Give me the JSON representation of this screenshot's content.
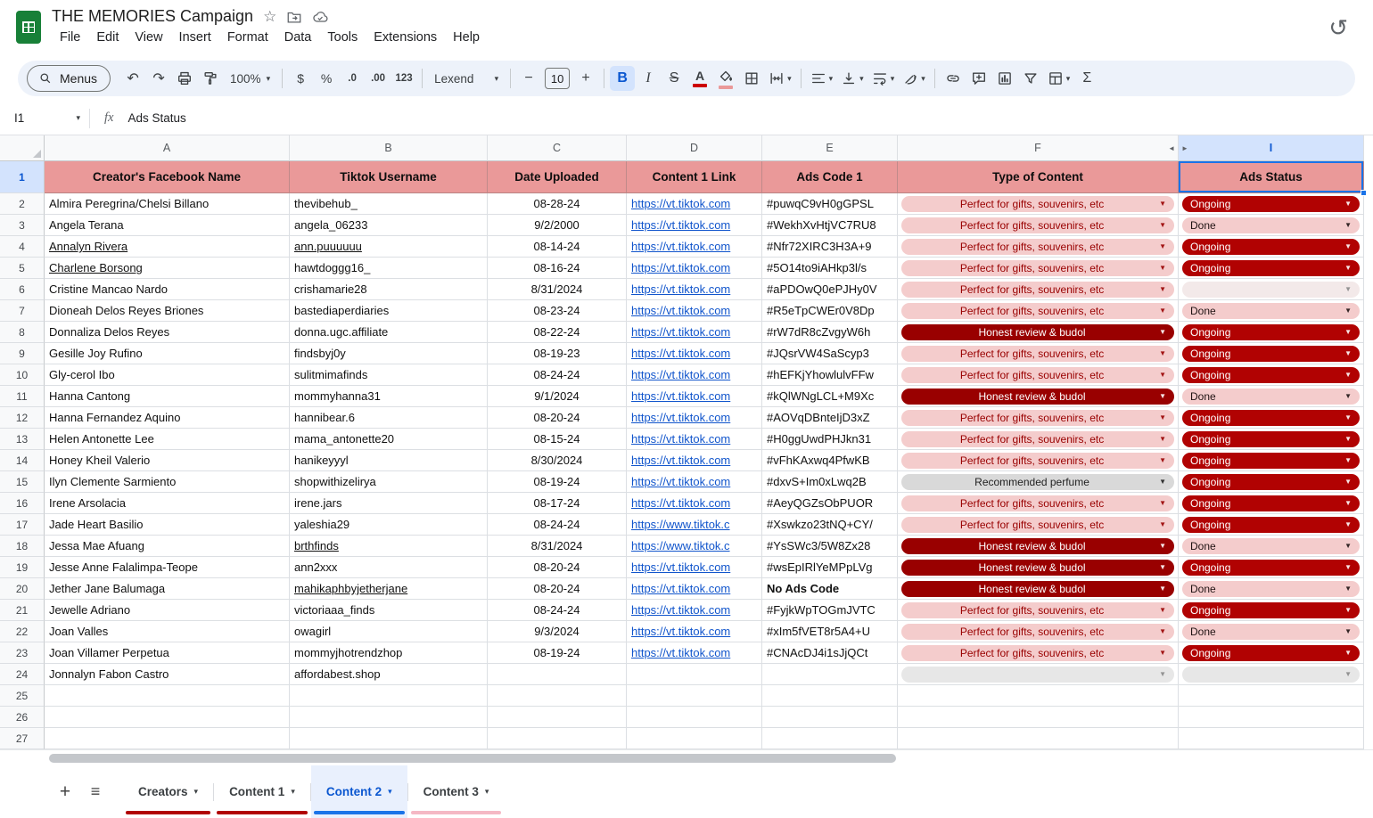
{
  "app": {
    "title": "THE MEMORIES Campaign",
    "menus": [
      "File",
      "Edit",
      "View",
      "Insert",
      "Format",
      "Data",
      "Tools",
      "Extensions",
      "Help"
    ]
  },
  "icons": {
    "undo": "↶",
    "redo": "↷",
    "star": "☆",
    "sigma": "Σ",
    "history": "↺",
    "dropdown": "▾",
    "chip_arrow": "▼",
    "plus": "+",
    "hamburger": "≡",
    "left_hidden": "◄",
    "right_hidden": "►"
  },
  "toolbar": {
    "menus_label": "Menus",
    "zoom_value": "100%",
    "currency": "$",
    "percent": "%",
    "dec_decrease": ".0",
    "dec_increase": ".00",
    "more_formats": "123",
    "font_name": "Lexend",
    "font_size": "10",
    "minus": "−",
    "plus": "+",
    "bold": "B",
    "italic": "I",
    "strike": "S",
    "text_color": "A"
  },
  "formula_bar": {
    "cell_ref": "I1",
    "fx": "fx",
    "value": "Ads Status"
  },
  "colors": {
    "header_fill": "#ea9999",
    "chip_light": "#f4cccc",
    "chip_dark_red": "#990000",
    "status_red": "#b10202",
    "chip_gray": "#d9d9d9",
    "selection_blue": "#1a73e8",
    "link_blue": "#1155cc",
    "text_color_indicator": "#cc0000",
    "fill_color_indicator": "#ea9999"
  },
  "grid": {
    "col_letters": [
      "A",
      "B",
      "C",
      "D",
      "E",
      "F",
      "I"
    ],
    "headers": [
      "Creator's Facebook Name",
      "Tiktok Username",
      "Date Uploaded",
      "Content 1 Link",
      "Ads Code 1",
      "Type of Content",
      "Ads Status"
    ],
    "header_row_number": 1,
    "empty_row_numbers": [
      25,
      26,
      27
    ],
    "rows": [
      {
        "n": 2,
        "name": "Almira Peregrina/Chelsi Billano",
        "user": "thevibehub_",
        "date": "08-28-24",
        "link": "https://vt.tiktok.com",
        "code": "#puwqC9vH0gGPSL",
        "type": {
          "label": "Perfect for gifts, souvenirs, etc",
          "style": "pink"
        },
        "status": {
          "label": "Ongoing",
          "style": "ongoing"
        }
      },
      {
        "n": 3,
        "name": "Angela Terana",
        "user": "angela_06233",
        "date": "9/2/2000",
        "link": "https://vt.tiktok.com",
        "code": "#WekhXvHtjVC7RU8",
        "type": {
          "label": "Perfect for gifts, souvenirs, etc",
          "style": "pink"
        },
        "status": {
          "label": "Done",
          "style": "done"
        }
      },
      {
        "n": 4,
        "name": "Annalyn Rivera",
        "nu": true,
        "user": "ann.puuuuuu",
        "uu": true,
        "date": "08-14-24",
        "link": "https://vt.tiktok.com",
        "code": "#Nfr72XIRC3H3A+9",
        "type": {
          "label": "Perfect for gifts, souvenirs, etc",
          "style": "pink"
        },
        "status": {
          "label": "Ongoing",
          "style": "ongoing"
        }
      },
      {
        "n": 5,
        "name": "Charlene Borsong",
        "nu": true,
        "user": "hawtdoggg16_",
        "date": "08-16-24",
        "link": "https://vt.tiktok.com",
        "code": "#5O14to9iAHkp3l/s",
        "type": {
          "label": "Perfect for gifts, souvenirs, etc",
          "style": "pink"
        },
        "status": {
          "label": "Ongoing",
          "style": "ongoing"
        }
      },
      {
        "n": 6,
        "name": "Cristine Mancao Nardo",
        "user": "crishamarie28",
        "date": "8/31/2024",
        "link": "https://vt.tiktok.com",
        "code": "#aPDOwQ0ePJHy0V",
        "type": {
          "label": "Perfect for gifts, souvenirs, etc",
          "style": "pink"
        },
        "status": {
          "label": "",
          "style": "empty"
        }
      },
      {
        "n": 7,
        "name": "Dioneah Delos Reyes Briones",
        "user": "bastediaperdiaries",
        "date": "08-23-24",
        "link": "https://vt.tiktok.com",
        "code": "#R5eTpCWEr0V8Dp",
        "type": {
          "label": "Perfect for gifts, souvenirs, etc",
          "style": "pink"
        },
        "status": {
          "label": "Done",
          "style": "done"
        }
      },
      {
        "n": 8,
        "name": "Donnaliza Delos Reyes",
        "user": "donna.ugc.affiliate",
        "date": "08-22-24",
        "link": "https://vt.tiktok.com",
        "code": "#rW7dR8cZvgyW6h",
        "type": {
          "label": "Honest review & budol",
          "style": "dark"
        },
        "status": {
          "label": "Ongoing",
          "style": "ongoing"
        }
      },
      {
        "n": 9,
        "name": "Gesille Joy Rufino",
        "user": "findsbyj0y",
        "date": "08-19-23",
        "link": "https://vt.tiktok.com",
        "code": "#JQsrVW4SaScyp3",
        "type": {
          "label": "Perfect for gifts, souvenirs, etc",
          "style": "pink"
        },
        "status": {
          "label": "Ongoing",
          "style": "ongoing"
        }
      },
      {
        "n": 10,
        "name": "Gly-cerol Ibo",
        "user": "sulitmimafinds",
        "date": "08-24-24",
        "link": "https://vt.tiktok.com",
        "code": "#hEFKjYhowlulvFFw",
        "type": {
          "label": "Perfect for gifts, souvenirs, etc",
          "style": "pink"
        },
        "status": {
          "label": "Ongoing",
          "style": "ongoing"
        }
      },
      {
        "n": 11,
        "name": "Hanna Cantong",
        "user": "mommyhanna31",
        "date": "9/1/2024",
        "link": "https://vt.tiktok.com",
        "code": "#kQlWNgLCL+M9Xc",
        "type": {
          "label": "Honest review & budol",
          "style": "dark"
        },
        "status": {
          "label": "Done",
          "style": "done"
        }
      },
      {
        "n": 12,
        "name": "Hanna Fernandez Aquino",
        "user": "hannibear.6",
        "date": "08-20-24",
        "link": "https://vt.tiktok.com",
        "code": "#AOVqDBnteIjD3xZ",
        "type": {
          "label": "Perfect for gifts, souvenirs, etc",
          "style": "pink"
        },
        "status": {
          "label": "Ongoing",
          "style": "ongoing"
        }
      },
      {
        "n": 13,
        "name": "Helen Antonette Lee",
        "user": "mama_antonette20",
        "date": "08-15-24",
        "link": "https://vt.tiktok.com",
        "code": "#H0ggUwdPHJkn31",
        "type": {
          "label": "Perfect for gifts, souvenirs, etc",
          "style": "pink"
        },
        "status": {
          "label": "Ongoing",
          "style": "ongoing"
        }
      },
      {
        "n": 14,
        "name": "Honey Kheil Valerio",
        "user": "hanikeyyyl",
        "date": "8/30/2024",
        "link": "https://vt.tiktok.com",
        "code": "#vFhKAxwq4PfwKB",
        "type": {
          "label": "Perfect for gifts, souvenirs, etc",
          "style": "pink"
        },
        "status": {
          "label": "Ongoing",
          "style": "ongoing"
        }
      },
      {
        "n": 15,
        "name": "Ilyn Clemente Sarmiento",
        "user": "shopwithizelirya",
        "date": "08-19-24",
        "link": "https://vt.tiktok.com",
        "code": "#dxvS+Im0xLwq2B",
        "type": {
          "label": "Recommended perfume",
          "style": "gray"
        },
        "status": {
          "label": "Ongoing",
          "style": "ongoing"
        }
      },
      {
        "n": 16,
        "name": "Irene Arsolacia",
        "user": "irene.jars",
        "date": "08-17-24",
        "link": "https://vt.tiktok.com",
        "code": "#AeyQGZsObPUOR",
        "type": {
          "label": "Perfect for gifts, souvenirs, etc",
          "style": "pink"
        },
        "status": {
          "label": "Ongoing",
          "style": "ongoing"
        }
      },
      {
        "n": 17,
        "name": "Jade Heart Basilio",
        "user": "yaleshia29",
        "date": "08-24-24",
        "link": "https://www.tiktok.c",
        "code": "#Xswkzo23tNQ+CY/",
        "type": {
          "label": "Perfect for gifts, souvenirs, etc",
          "style": "pink"
        },
        "status": {
          "label": "Ongoing",
          "style": "ongoing"
        }
      },
      {
        "n": 18,
        "name": "Jessa Mae Afuang",
        "user": "brthfinds",
        "uu": true,
        "date": "8/31/2024",
        "link": "https://www.tiktok.c",
        "code": "#YsSWc3/5W8Zx28",
        "type": {
          "label": "Honest review & budol",
          "style": "dark"
        },
        "status": {
          "label": "Done",
          "style": "done"
        }
      },
      {
        "n": 19,
        "name": "Jesse Anne Falalimpa-Teope",
        "user": "ann2xxx",
        "date": "08-20-24",
        "link": "https://vt.tiktok.com",
        "code": "#wsEpIRlYeMPpLVg",
        "type": {
          "label": "Honest review & budol",
          "style": "dark"
        },
        "status": {
          "label": "Ongoing",
          "style": "ongoing"
        }
      },
      {
        "n": 20,
        "name": "Jether Jane Balumaga",
        "user": "mahikaphbyjetherjane",
        "uu": true,
        "date": "08-20-24",
        "link": "https://vt.tiktok.com",
        "code": "No Ads Code",
        "cb": true,
        "type": {
          "label": "Honest review & budol",
          "style": "dark"
        },
        "status": {
          "label": "Done",
          "style": "done"
        }
      },
      {
        "n": 21,
        "name": "Jewelle Adriano",
        "user": "victoriaaa_finds",
        "date": "08-24-24",
        "link": "https://vt.tiktok.com",
        "code": "#FyjkWpTOGmJVTC",
        "type": {
          "label": "Perfect for gifts, souvenirs, etc",
          "style": "pink"
        },
        "status": {
          "label": "Ongoing",
          "style": "ongoing"
        }
      },
      {
        "n": 22,
        "name": "Joan Valles",
        "user": "owagirl",
        "date": "9/3/2024",
        "link": "https://vt.tiktok.com",
        "code": "#xIm5fVET8r5A4+U",
        "type": {
          "label": "Perfect for gifts, souvenirs, etc",
          "style": "pink"
        },
        "status": {
          "label": "Done",
          "style": "done"
        }
      },
      {
        "n": 23,
        "name": "Joan Villamer Perpetua",
        "user": "mommyjhotrendzhop",
        "date": "08-19-24",
        "link": "https://vt.tiktok.com",
        "code": "#CNAcDJ4i1sJjQCt",
        "type": {
          "label": "Perfect for gifts, souvenirs, etc",
          "style": "pink"
        },
        "status": {
          "label": "Ongoing",
          "style": "ongoing"
        }
      },
      {
        "n": 24,
        "name": "Jonnalyn Fabon Castro",
        "user": "affordabest.shop",
        "date": "",
        "link": "",
        "code": "",
        "type": {
          "label": "",
          "style": "emptyg"
        },
        "status": {
          "label": "",
          "style": "emptyg"
        }
      }
    ]
  },
  "sheet_tabs": {
    "tabs": [
      {
        "label": "Creators",
        "color": "#b10202",
        "active": false
      },
      {
        "label": "Content 1",
        "color": "#b10202",
        "active": false
      },
      {
        "label": "Content 2",
        "color": "#1a73e8",
        "active": true
      },
      {
        "label": "Content 3",
        "color": "#f5b8c4",
        "active": false
      }
    ]
  }
}
